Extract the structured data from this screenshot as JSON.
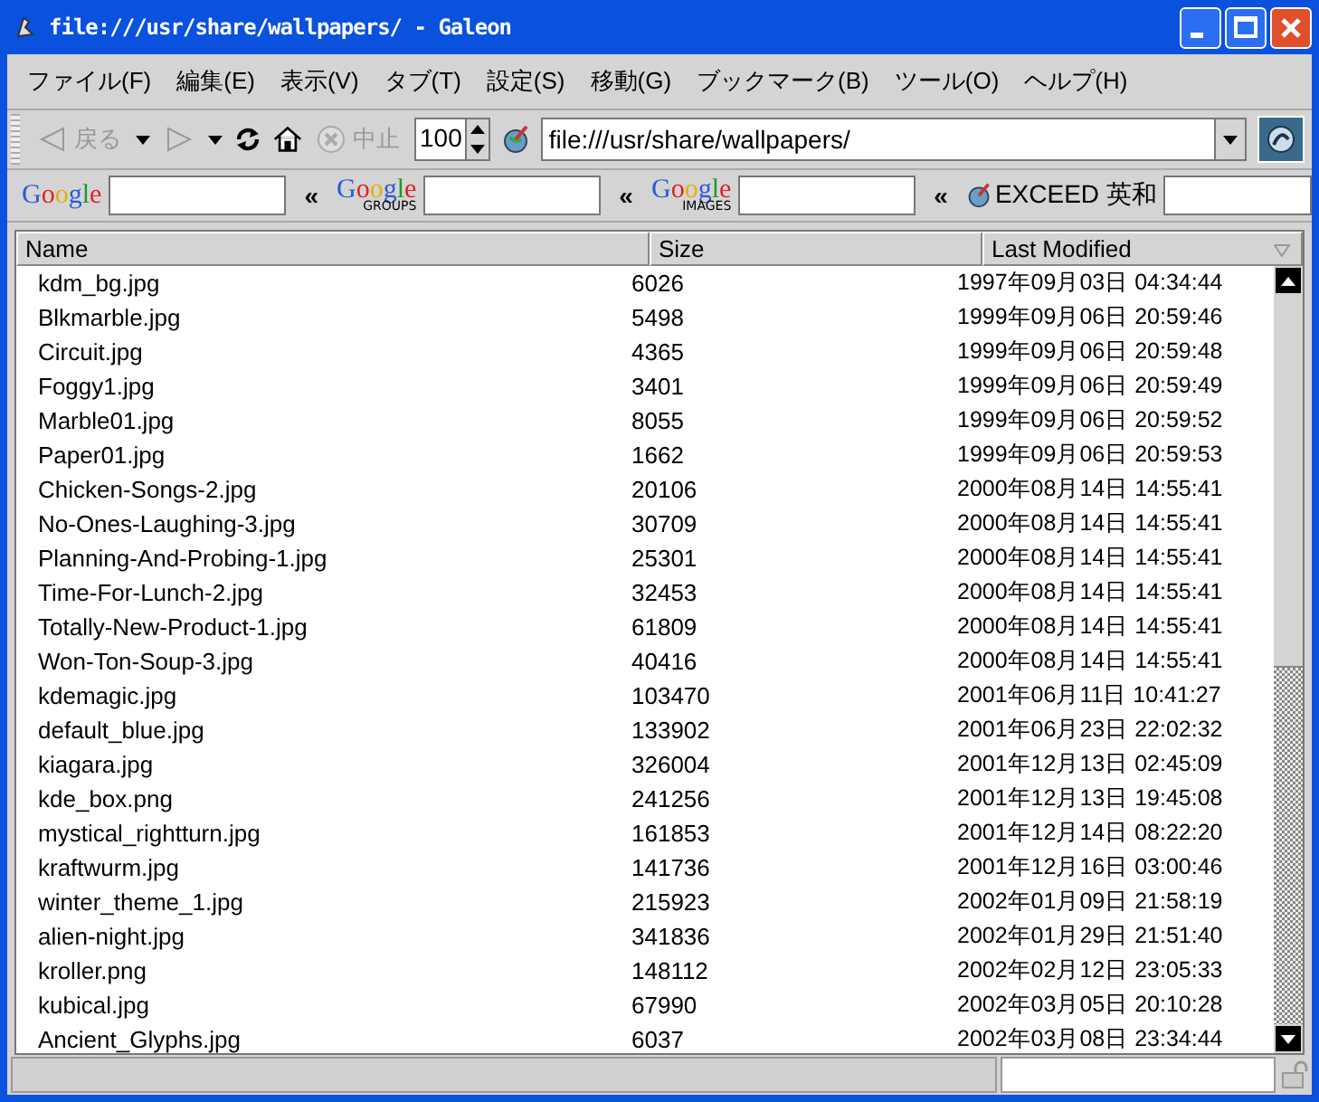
{
  "window": {
    "title": "file:///usr/share/wallpapers/ - Galeon"
  },
  "menu": [
    "ファイル(F)",
    "編集(E)",
    "表示(V)",
    "タブ(T)",
    "設定(S)",
    "移動(G)",
    "ブックマーク(B)",
    "ツール(O)",
    "ヘルプ(H)"
  ],
  "toolbar": {
    "back": {
      "label": "戻る",
      "disabled": true
    },
    "forward": {
      "disabled": true
    },
    "stop": {
      "label": "中止",
      "disabled": true
    },
    "zoom": "100",
    "url": "file:///usr/share/wallpapers/"
  },
  "search_bar": [
    {
      "logo": "Google",
      "kind": "google"
    },
    {
      "logo": "Google",
      "sub": "GROUPS",
      "kind": "google"
    },
    {
      "logo": "Google",
      "sub": "IMAGES",
      "kind": "google"
    },
    {
      "logo": "EXCEED 英和",
      "kind": "dict"
    }
  ],
  "search_separator": "«",
  "table": {
    "columns": [
      "Name",
      "Size",
      "Last Modified"
    ],
    "rows": [
      [
        "kdm_bg.jpg",
        "6026",
        "1997年09月03日 04:34:44"
      ],
      [
        "Blkmarble.jpg",
        "5498",
        "1999年09月06日 20:59:46"
      ],
      [
        "Circuit.jpg",
        "4365",
        "1999年09月06日 20:59:48"
      ],
      [
        "Foggy1.jpg",
        "3401",
        "1999年09月06日 20:59:49"
      ],
      [
        "Marble01.jpg",
        "8055",
        "1999年09月06日 20:59:52"
      ],
      [
        "Paper01.jpg",
        "1662",
        "1999年09月06日 20:59:53"
      ],
      [
        "Chicken-Songs-2.jpg",
        "20106",
        "2000年08月14日 14:55:41"
      ],
      [
        "No-Ones-Laughing-3.jpg",
        "30709",
        "2000年08月14日 14:55:41"
      ],
      [
        "Planning-And-Probing-1.jpg",
        "25301",
        "2000年08月14日 14:55:41"
      ],
      [
        "Time-For-Lunch-2.jpg",
        "32453",
        "2000年08月14日 14:55:41"
      ],
      [
        "Totally-New-Product-1.jpg",
        "61809",
        "2000年08月14日 14:55:41"
      ],
      [
        "Won-Ton-Soup-3.jpg",
        "40416",
        "2000年08月14日 14:55:41"
      ],
      [
        "kdemagic.jpg",
        "103470",
        "2001年06月11日 10:41:27"
      ],
      [
        "default_blue.jpg",
        "133902",
        "2001年06月23日 22:02:32"
      ],
      [
        "kiagara.jpg",
        "326004",
        "2001年12月13日 02:45:09"
      ],
      [
        "kde_box.png",
        "241256",
        "2001年12月13日 19:45:08"
      ],
      [
        "mystical_rightturn.jpg",
        "161853",
        "2001年12月14日 08:22:20"
      ],
      [
        "kraftwurm.jpg",
        "141736",
        "2001年12月16日 03:00:46"
      ],
      [
        "winter_theme_1.jpg",
        "215923",
        "2002年01月09日 21:58:19"
      ],
      [
        "alien-night.jpg",
        "341836",
        "2002年01月29日 21:51:40"
      ],
      [
        "kroller.png",
        "148112",
        "2002年02月12日 23:05:33"
      ],
      [
        "kubical.jpg",
        "67990",
        "2002年03月05日 20:10:28"
      ],
      [
        "Ancient_Glyphs.jpg",
        "6037",
        "2002年03月08日 23:34:44"
      ]
    ]
  }
}
